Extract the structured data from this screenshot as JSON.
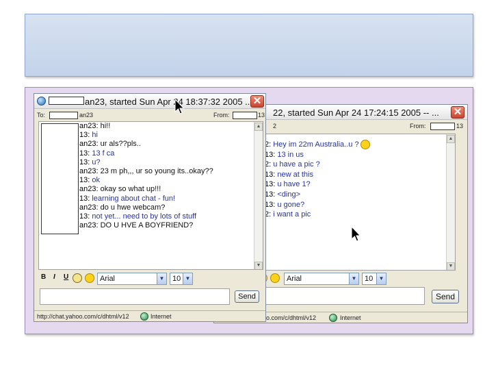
{
  "window_back": {
    "title": "22, started Sun Apr 24 17:24:15 2005 --  ...",
    "close_label": "✕",
    "to_label": "2",
    "from_label": "From:",
    "from_suffix": "13",
    "messages": [
      {
        "who": "2:",
        "text": "Hey im 22m Australia..u ?"
      },
      {
        "who": "13:",
        "text": "13 in us"
      },
      {
        "who": "2:",
        "text": "u have a pic ?"
      },
      {
        "who": "13:",
        "text": "new at this"
      },
      {
        "who": "13:",
        "text": "u have 1?"
      },
      {
        "who": "13:",
        "text": "<ding>"
      },
      {
        "who": "13:",
        "text": "u gone?"
      },
      {
        "who": "2:",
        "text": "i want a pic"
      }
    ],
    "font": "Arial",
    "size": "10",
    "send": "Send",
    "status_url": "hoo.com/c/dhtml/v12",
    "status_zone": "Internet"
  },
  "window_front": {
    "title": "an23, started Sun Apr 24 18:37:32 2005 ...",
    "close_label": "✕",
    "to_label": "To:",
    "to_suffix": "an23",
    "from_label": "From:",
    "from_suffix": "13",
    "messages": [
      {
        "who": "an23:",
        "text": "hi!!",
        "style": "black"
      },
      {
        "who": "13:",
        "text": "hi",
        "style": "blue"
      },
      {
        "who": "an23:",
        "text": "ur als??pls..",
        "style": "black"
      },
      {
        "who": "13:",
        "text": "13 f ca",
        "style": "blue"
      },
      {
        "who": "13:",
        "text": "u?",
        "style": "blue"
      },
      {
        "who": "an23:",
        "text": "23 m ph,,, ur so young its..okay??",
        "style": "black"
      },
      {
        "who": "13:",
        "text": "ok",
        "style": "blue"
      },
      {
        "who": "an23:",
        "text": "okay  so what up!!!",
        "style": "black"
      },
      {
        "who": "13:",
        "text": "learning about chat - fun!",
        "style": "blue"
      },
      {
        "who": "an23:",
        "text": "do u hwe webcam?",
        "style": "black"
      },
      {
        "who": "13:",
        "text": "not yet... need to by lots of stuff",
        "style": "blue"
      },
      {
        "who": "an23:",
        "text": "DO U HVE A BOYFRIEND?",
        "style": "black"
      }
    ],
    "format_bold": "B",
    "format_italic": "I",
    "format_underline": "U",
    "font": "Arial",
    "size": "10",
    "send": "Send",
    "status_url": "http://chat.yahoo.com/c/dhtml/v12",
    "status_zone": "Internet"
  }
}
